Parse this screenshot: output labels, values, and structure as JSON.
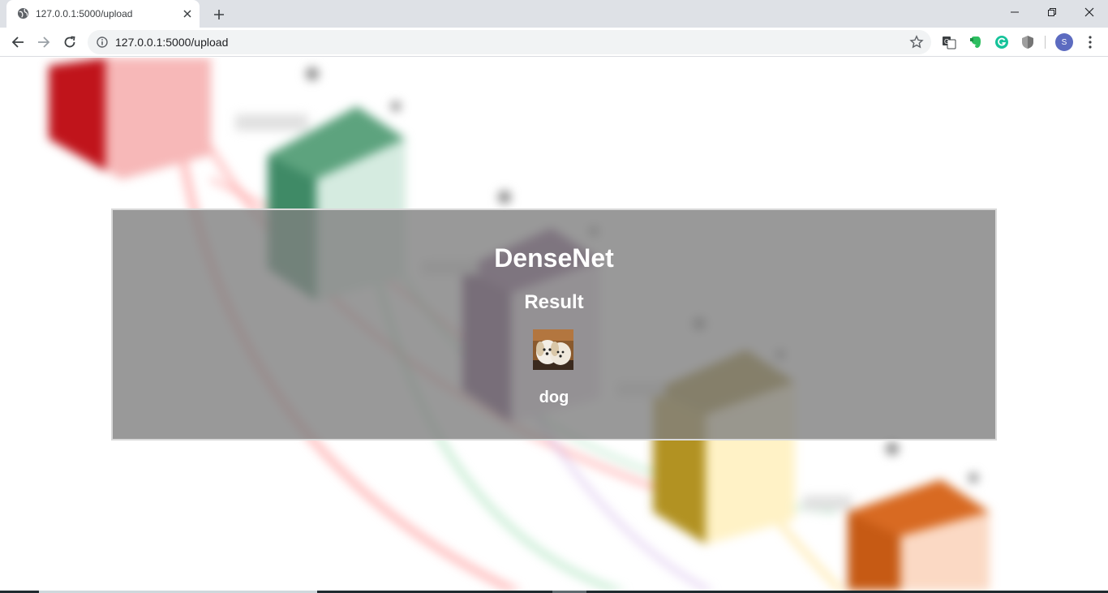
{
  "browser": {
    "tab": {
      "title": "127.0.0.1:5000/upload"
    },
    "address_bar": {
      "url": "127.0.0.1:5000/upload"
    },
    "profile_initial": "S",
    "extensions": [
      "translate-icon",
      "evernote-icon",
      "grammarly-icon",
      "shield-extension-icon"
    ]
  },
  "page": {
    "heading": "DenseNet",
    "subheading": "Result",
    "prediction": "dog"
  },
  "colors": {
    "panel_overlay": "#808080",
    "tabstrip": "#dee1e6",
    "accent_profile": "#5c6bc0"
  }
}
